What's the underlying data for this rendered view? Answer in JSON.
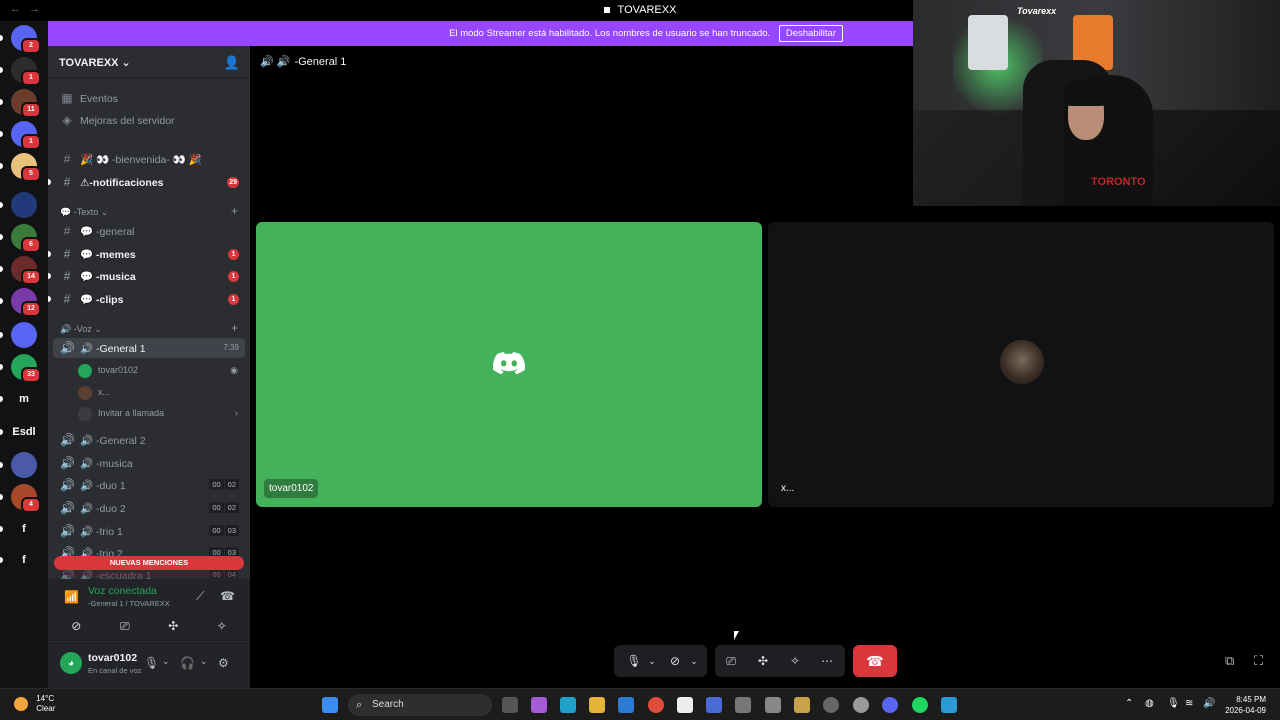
{
  "window": {
    "title": "TOVAREXX"
  },
  "banner": {
    "text": "El modo Streamer está habilitado. Los nombres de usuario se han truncado.",
    "button": "Deshabilitar"
  },
  "servers": [
    {
      "label": "",
      "badge": "2",
      "color": "#5865f2"
    },
    {
      "label": "",
      "badge": "1",
      "color": "#2c2c2c"
    },
    {
      "label": "",
      "badge": "11",
      "color": "#6b3b2b"
    },
    {
      "label": "",
      "badge": "1",
      "color": "#5865f2"
    },
    {
      "label": "",
      "badge": "5",
      "color": "#e8c27a"
    },
    {
      "label": "",
      "badge": "",
      "color": "#233a7a"
    },
    {
      "label": "",
      "badge": "6",
      "color": "#3a7a3a"
    },
    {
      "label": "",
      "badge": "14",
      "color": "#6b2b2b"
    },
    {
      "label": "",
      "badge": "12",
      "color": "#7a3aa8"
    },
    {
      "label": "",
      "badge": "",
      "color": "#5865f2"
    },
    {
      "label": "",
      "badge": "33",
      "color": "#23a55a"
    },
    {
      "label": "m",
      "badge": "",
      "color": "#111214"
    },
    {
      "label": "Esdl",
      "badge": "",
      "color": "#111214"
    },
    {
      "label": "",
      "badge": "",
      "color": "#4a5aa8"
    },
    {
      "label": "",
      "badge": "4",
      "color": "#a84a2a"
    },
    {
      "label": "f",
      "badge": "",
      "color": "#111214"
    },
    {
      "label": "f",
      "badge": "",
      "color": "#111214"
    }
  ],
  "guild": {
    "name": "TOVAREXX ⌄"
  },
  "sidebar": {
    "events": "Eventos",
    "boosts": "Mejoras del servidor",
    "ch_bienvenida": "🎉 👀 -bienvenida- 👀 🎉",
    "ch_notificaciones": "⚠-notificaciones",
    "notif_badge": "29",
    "cat_text": "💬 -Texto ⌄",
    "ch_general": "💬 -general",
    "ch_memes": "💬 -memes",
    "ch_musica": "💬 -musica",
    "ch_clips": "💬 -clips",
    "badge_1": "1",
    "cat_voice": "🔊 -Voz ⌄",
    "vc_general1": "🔊 -General 1",
    "vc_general1_time": "7:39",
    "vc_user1": "tovar0102",
    "vc_user2": "x...",
    "vc_invite": "Invitar a llamada",
    "vc_general2": "🔊 -General 2",
    "vc_musica": "🔊 -musica",
    "vc_duo1": "🔊 -duo 1",
    "vc_duo2": "🔊 -duo 2",
    "vc_trio1": "🔊 -trio 1",
    "vc_trio2": "🔊 -trio 2",
    "vc_escuadra1": "🔊 -escuadra 1",
    "count_00": "00",
    "count_02": "02",
    "count_03": "03",
    "count_04": "04",
    "mentions": "NUEVAS MENCIONES"
  },
  "voice_panel": {
    "status": "Voz conectada",
    "location": "-General 1 / TOVAREXX"
  },
  "user_panel": {
    "name": "tovar0102",
    "status": "En canal de voz"
  },
  "main": {
    "channel": "-General 1"
  },
  "tiles": [
    {
      "label": "tovar0102"
    },
    {
      "label": "x..."
    }
  ],
  "webcam": {
    "logo": "Tovarexx",
    "shirt_text": "TORONTO"
  },
  "taskbar": {
    "temp": "14°C",
    "weather": "Clear",
    "search": "Search",
    "time": "8:45 PM",
    "date": "2026-04-09"
  },
  "colors": {
    "accent": "#5865f2",
    "banner": "#9747ff",
    "green": "#23a55a",
    "tile_green": "#43b25a",
    "red": "#da373c"
  }
}
